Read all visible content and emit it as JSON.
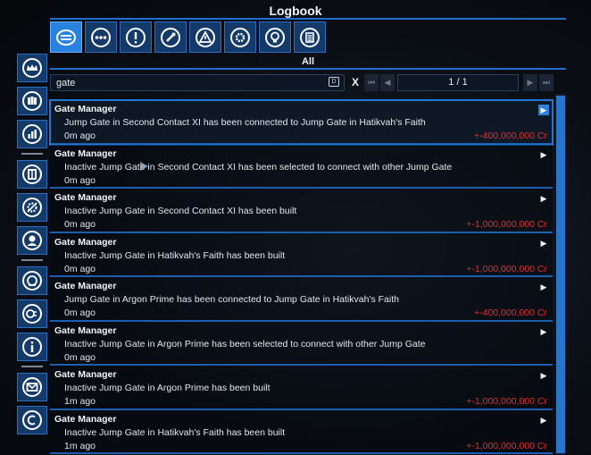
{
  "window": {
    "title": "Logbook"
  },
  "categories": {
    "top": [
      {
        "icon": "list-icon",
        "active": true
      },
      {
        "icon": "more-dots-icon",
        "active": false
      },
      {
        "icon": "alert-circle-icon",
        "active": false
      },
      {
        "icon": "wrench-icon",
        "active": false
      },
      {
        "icon": "warning-triangle-icon",
        "active": false
      },
      {
        "icon": "gear-icon",
        "active": false
      },
      {
        "icon": "lightbulb-icon",
        "active": false
      },
      {
        "icon": "document-list-icon",
        "active": false
      }
    ],
    "current_label": "All",
    "left": [
      "crown-icon",
      "faction-icon",
      "bar-chart-icon",
      "station-icon",
      "gear-tools-icon",
      "person-icon",
      "globe-icon",
      "contacts-icon",
      "info-icon",
      "mail-icon",
      "currency-icon"
    ]
  },
  "search": {
    "value": "gate",
    "kbd_label": "D",
    "clear_label": "X"
  },
  "pagination": {
    "label": "1 / 1",
    "first": "⏮",
    "prev": "◀",
    "next": "▶",
    "last": "⏭"
  },
  "entries": [
    {
      "title": "Gate Manager",
      "text": "Jump Gate in Second Contact XI has been connected to Jump Gate in Hatikvah's Faith",
      "time": "0m ago",
      "money": "+-400,000,000 Cr",
      "selected": true
    },
    {
      "title": "Gate Manager",
      "text": "Inactive Jump Gate in Second Contact XI has been selected to connect with other Jump Gate",
      "time": "0m ago",
      "money": "",
      "selected": false
    },
    {
      "title": "Gate Manager",
      "text": "Inactive Jump Gate in Second Contact XI has been built",
      "time": "0m ago",
      "money": "+-1,000,000,000 Cr",
      "selected": false
    },
    {
      "title": "Gate Manager",
      "text": "Inactive Jump Gate in Hatikvah's Faith has been built",
      "time": "0m ago",
      "money": "+-1,000,000,000 Cr",
      "selected": false
    },
    {
      "title": "Gate Manager",
      "text": "Jump Gate in Argon Prime has been connected to Jump Gate in Hatikvah's Faith",
      "time": "0m ago",
      "money": "+-400,000,000 Cr",
      "selected": false
    },
    {
      "title": "Gate Manager",
      "text": "Inactive Jump Gate in Argon Prime has been selected to connect with other Jump Gate",
      "time": "0m ago",
      "money": "",
      "selected": false
    },
    {
      "title": "Gate Manager",
      "text": "Inactive Jump Gate in Argon Prime has been built",
      "time": "1m ago",
      "money": "+-1,000,000,000 Cr",
      "selected": false
    },
    {
      "title": "Gate Manager",
      "text": "Inactive Jump Gate in Hatikvah's Faith has been built",
      "time": "1m ago",
      "money": "+-1,000,000,000 Cr",
      "selected": false
    }
  ],
  "colors": {
    "accent": "#2a82e0",
    "money_negative": "#e03030",
    "separator": "#1b5fae"
  }
}
